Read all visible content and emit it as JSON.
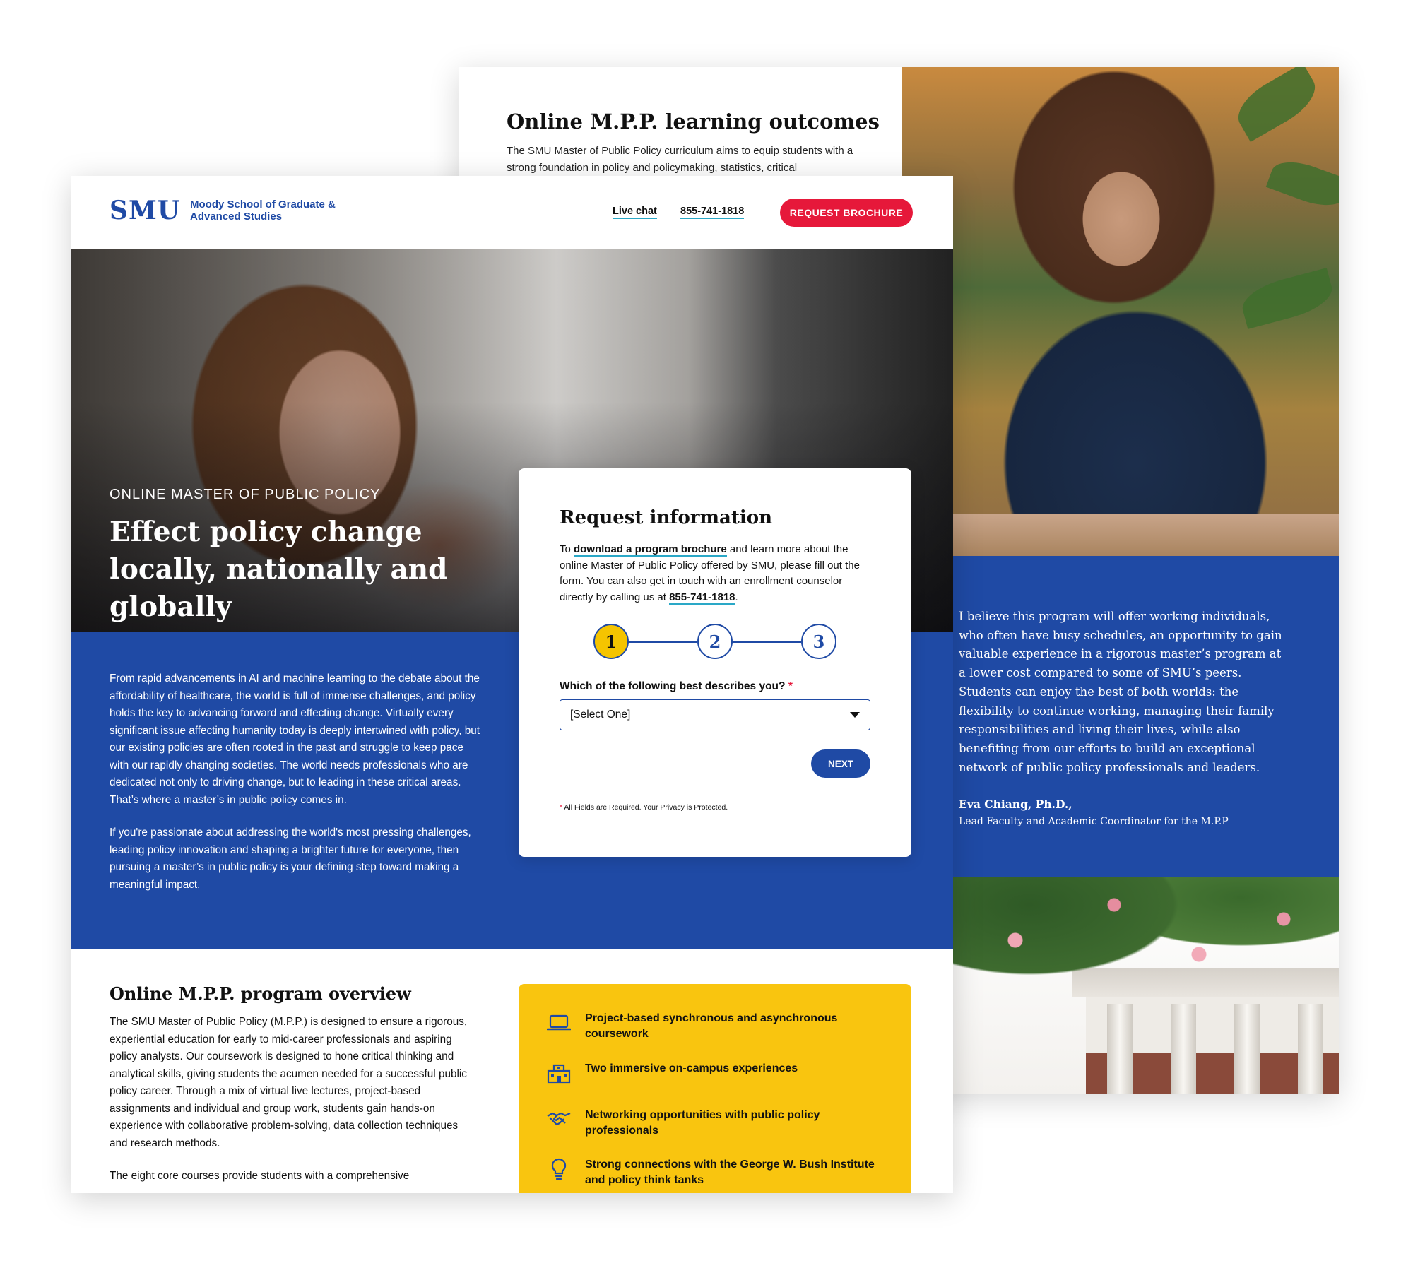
{
  "back_page": {
    "title": "Online M.P.P. learning outcomes",
    "body": "The SMU Master of Public Policy curriculum aims to equip students with a strong foundation in policy and policymaking, statistics, critical",
    "quote": "I believe this program will offer working individuals, who often have busy schedules, an opportunity to gain valuable experience in a rigorous master’s program at a lower cost compared to some of SMU’s peers. Students can enjoy the best of both worlds: the flexibility to continue working, managing their family responsibilities and living their lives, while also benefiting from our efforts to build an exceptional network of public policy professionals and leaders.",
    "quote_name": "Eva Chiang, Ph.D.,",
    "quote_role": "Lead Faculty and Academic Coordinator for the M.P.P"
  },
  "header": {
    "logo": "SMU",
    "logo_sub": "Moody School of Graduate & Advanced Studies",
    "live_chat": "Live chat",
    "phone": "855-741-1818",
    "brochure_button": "REQUEST BROCHURE"
  },
  "hero": {
    "eyebrow": "ONLINE MASTER OF PUBLIC POLICY",
    "title": "Effect policy change locally, nationally and globally"
  },
  "intro": {
    "p1": "From rapid advancements in AI and machine learning to the debate about the affordability of healthcare, the world is full of immense challenges, and policy holds the key to advancing forward and effecting change. Virtually every significant issue affecting humanity today is deeply intertwined with policy, but our existing policies are often rooted in the past and struggle to keep pace with our rapidly changing societies. The world needs professionals who are dedicated not only to driving change, but to leading in these critical areas. That’s where a master’s in public policy comes in.",
    "p2": "If you're passionate about addressing the world's most pressing challenges, leading policy innovation and shaping a brighter future for everyone, then pursuing a master’s in public policy is your defining step toward making a meaningful impact."
  },
  "form": {
    "title": "Request information",
    "desc_prefix": "To ",
    "desc_link": "download a program brochure",
    "desc_middle": " and learn more about the online Master of Public Policy offered by SMU, please fill out the form. You can also get in touch with an enrollment counselor directly by calling us at ",
    "desc_phone": "855-741-1818",
    "desc_suffix": ".",
    "steps": [
      "1",
      "2",
      "3"
    ],
    "question": "Which of the following best describes you?",
    "required_mark": "*",
    "select_value": "[Select One]",
    "next_button": "NEXT",
    "note_mark": "*",
    "note": " All Fields are Required. Your Privacy is Protected."
  },
  "overview": {
    "title": "Online M.P.P. program overview",
    "p1": "The SMU Master of Public Policy (M.P.P.) is designed to ensure a rigorous, experiential education for early to mid-career professionals and aspiring policy analysts. Our coursework is designed to hone critical thinking and analytical skills, giving students the acumen needed for a successful public policy career. Through a mix of virtual live lectures, project-based assignments and individual and group work, students gain hands-on experience with collaborative problem-solving, data collection techniques and research methods.",
    "p2": "The eight core courses provide students with a comprehensive"
  },
  "features": [
    {
      "icon": "laptop-icon",
      "text": "Project-based synchronous and asynchronous coursework"
    },
    {
      "icon": "building-icon",
      "text": "Two immersive on-campus experiences"
    },
    {
      "icon": "handshake-icon",
      "text": "Networking opportunities with public policy professionals"
    },
    {
      "icon": "lightbulb-icon",
      "text": "Strong connections with the George W. Bush Institute and policy think tanks"
    }
  ],
  "colors": {
    "brand_blue": "#1f4aa5",
    "accent_red": "#e6183a",
    "accent_yellow": "#f9c50f",
    "link_underline": "#2aa8c7"
  }
}
